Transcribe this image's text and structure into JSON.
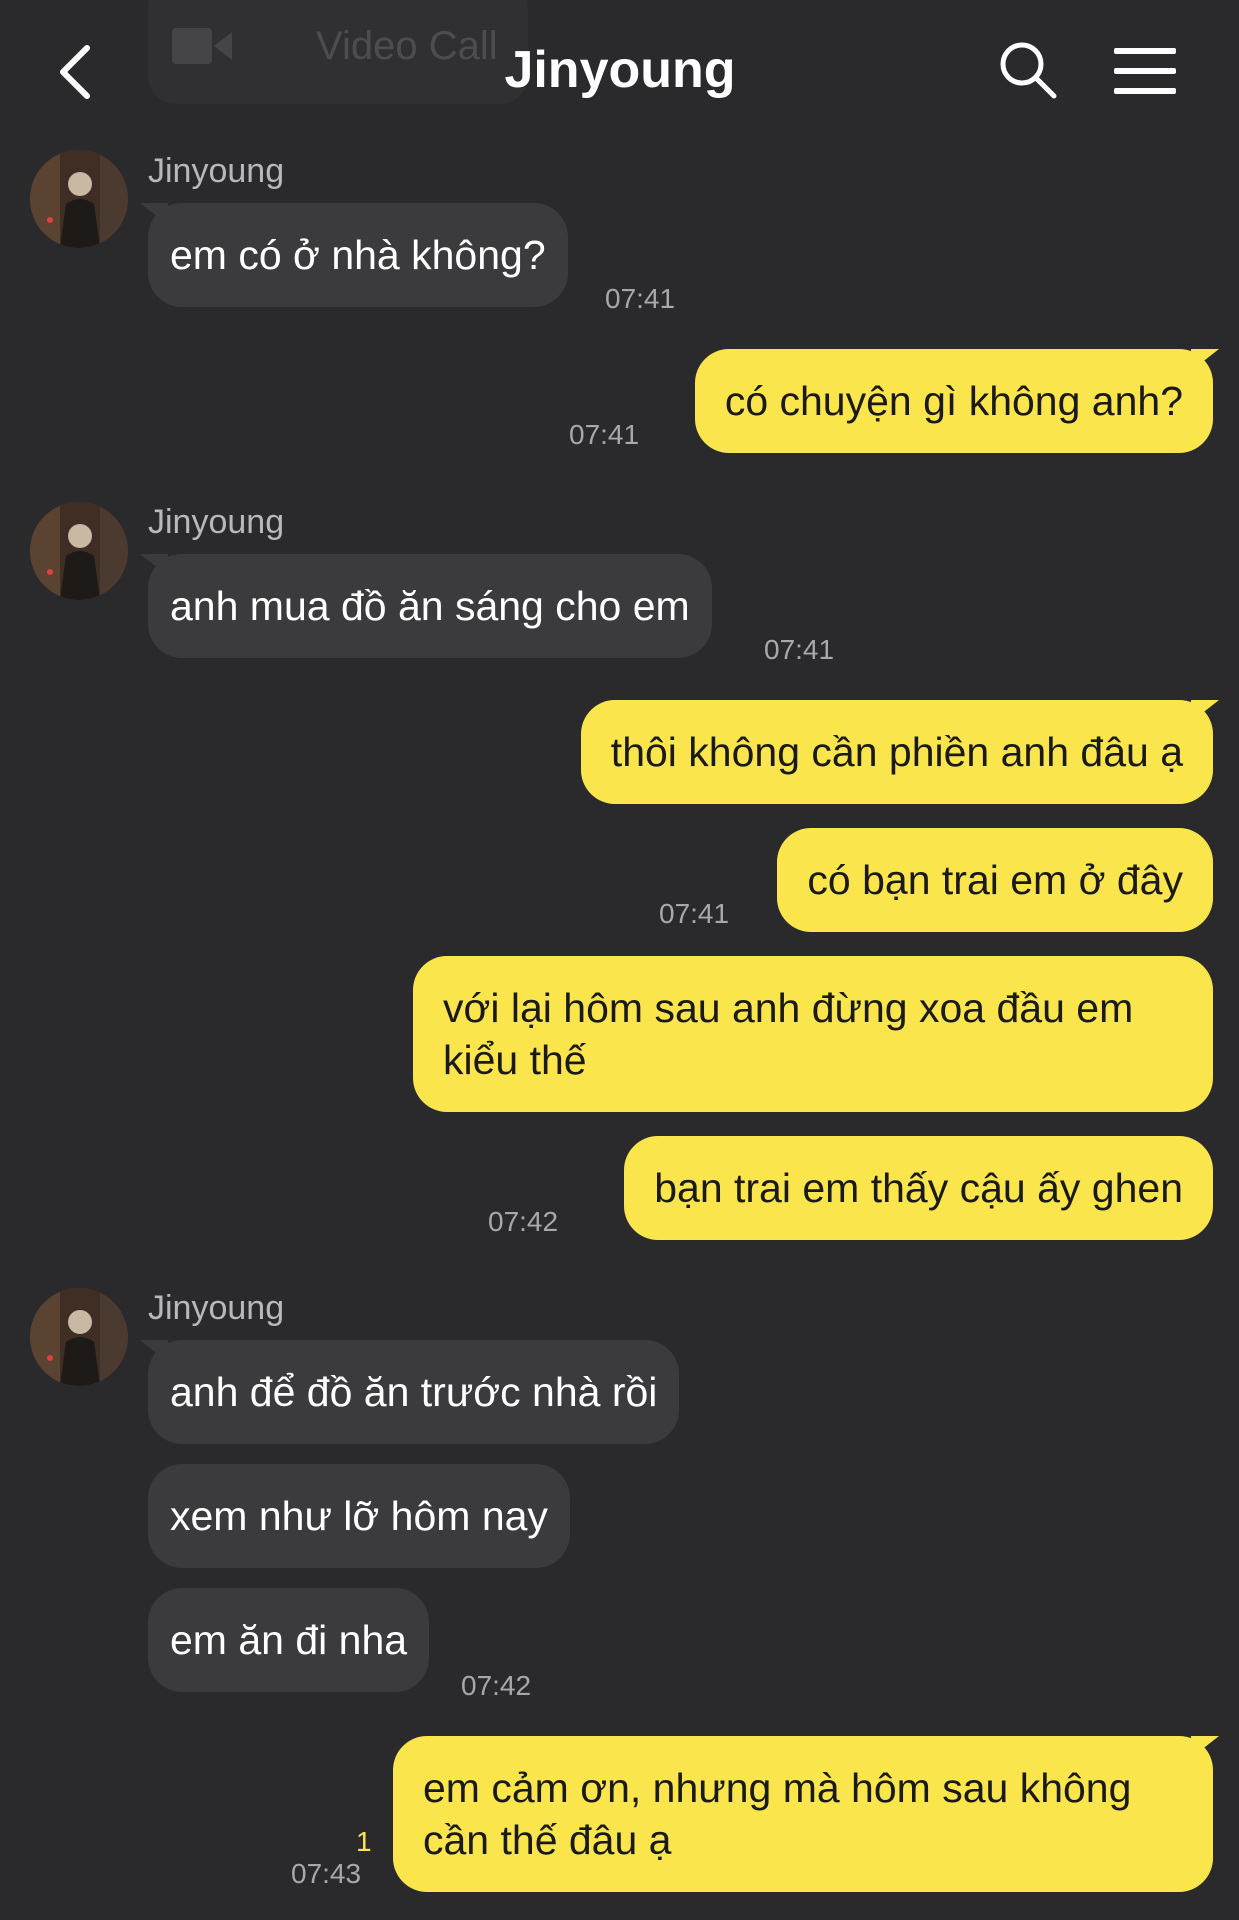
{
  "header": {
    "video_call_label": "Video Call",
    "title": "Jinyoung"
  },
  "contact_name": "Jinyoung",
  "messages": [
    {
      "text": "em có ở nhà không?",
      "time": "07:41"
    },
    {
      "text": "có chuyện gì không anh?",
      "time": "07:41"
    },
    {
      "text": "anh mua đồ ăn sáng cho em",
      "time": "07:41"
    },
    {
      "text": "thôi không cần phiền anh đâu ạ"
    },
    {
      "text": "có bạn trai em ở đây",
      "time": "07:41"
    },
    {
      "text": "với lại hôm sau anh đừng xoa đầu em kiểu thế"
    },
    {
      "text": "bạn trai em thấy cậu ấy ghen",
      "time": "07:42"
    },
    {
      "text": "anh để đồ ăn trước nhà rồi"
    },
    {
      "text": "xem như lỡ hôm nay"
    },
    {
      "text": "em ăn đi nha",
      "time": "07:42"
    },
    {
      "text": "em cảm ơn, nhưng mà hôm sau không cần thế đâu ạ",
      "time": "07:43",
      "unread": "1"
    }
  ],
  "colors": {
    "background": "#2a2a2d",
    "incoming_bubble": "#3b3b3e",
    "outgoing_bubble": "#fbe54d",
    "timestamp": "#a8a8ac"
  },
  "icons": [
    "back-chevron-icon",
    "video-camera-icon",
    "search-icon",
    "menu-icon"
  ]
}
